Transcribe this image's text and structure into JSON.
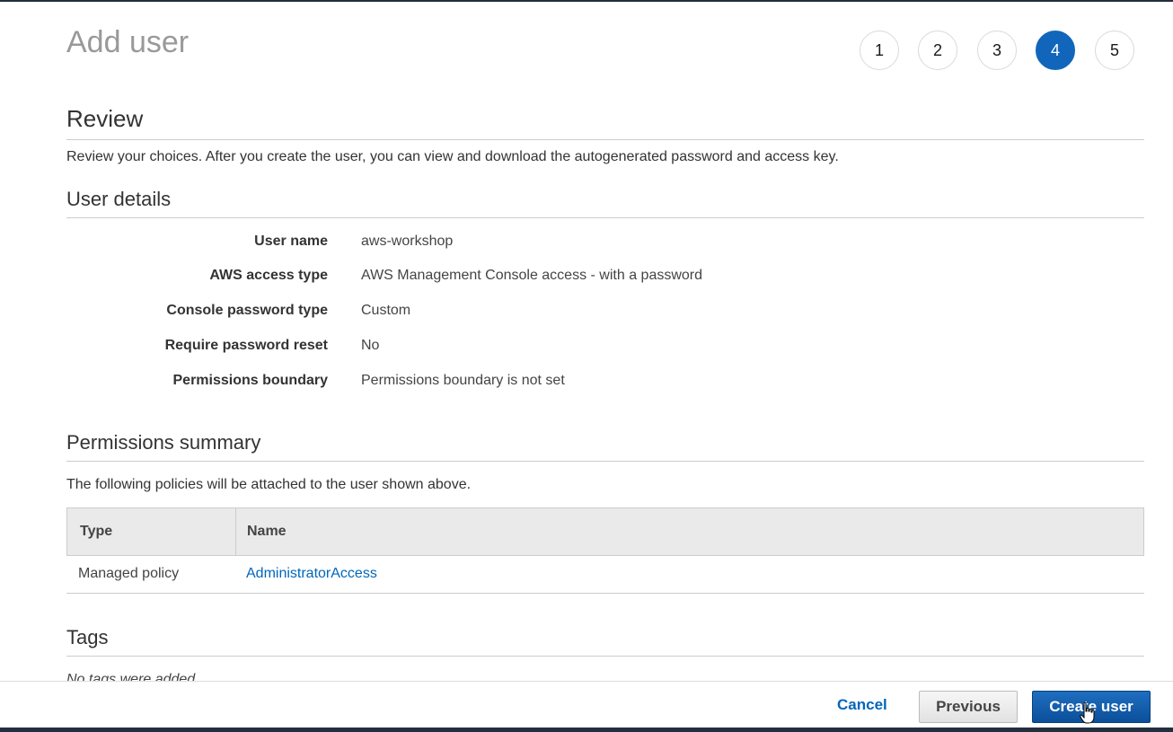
{
  "header": {
    "title": "Add user",
    "steps": [
      {
        "label": "1",
        "active": false
      },
      {
        "label": "2",
        "active": false
      },
      {
        "label": "3",
        "active": false
      },
      {
        "label": "4",
        "active": true
      },
      {
        "label": "5",
        "active": false
      }
    ]
  },
  "review": {
    "heading": "Review",
    "description": "Review your choices. After you create the user, you can view and download the autogenerated password and access key."
  },
  "user_details": {
    "heading": "User details",
    "rows": [
      {
        "label": "User name",
        "value": "aws-workshop"
      },
      {
        "label": "AWS access type",
        "value": "AWS Management Console access - with a password"
      },
      {
        "label": "Console password type",
        "value": "Custom"
      },
      {
        "label": "Require password reset",
        "value": "No"
      },
      {
        "label": "Permissions boundary",
        "value": "Permissions boundary is not set"
      }
    ]
  },
  "permissions": {
    "heading": "Permissions summary",
    "description": "The following policies will be attached to the user shown above.",
    "columns": {
      "type": "Type",
      "name": "Name"
    },
    "rows": [
      {
        "type": "Managed policy",
        "name": "AdministratorAccess"
      }
    ]
  },
  "tags": {
    "heading": "Tags",
    "empty_text": "No tags were added."
  },
  "footer": {
    "cancel_label": "Cancel",
    "previous_label": "Previous",
    "create_label": "Create user"
  },
  "colors": {
    "accent": "#1166bb",
    "link": "#0066bb",
    "topbar": "#232f3e"
  }
}
